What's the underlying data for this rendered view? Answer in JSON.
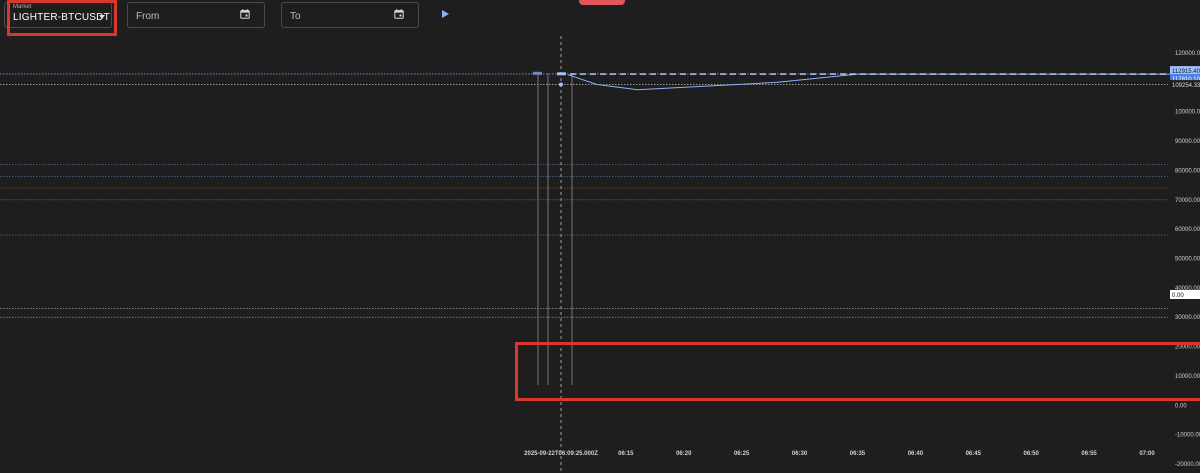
{
  "toolbar": {
    "market_label": "Market",
    "market_value": "LIGHTER-BTCUSDT",
    "from_label": "From",
    "to_label": "To"
  },
  "icons": {
    "dropdown": "chevron-down-icon",
    "calendar": "calendar-icon",
    "run": "play-icon"
  },
  "colors": {
    "background": "#1e1e1e",
    "highlight": "#d9362c",
    "series": "#8ab4f8",
    "tag_blue": "#4c7de0",
    "tag_light": "#9fc0ff",
    "red_tab": "#e0565b"
  },
  "chart_data": {
    "type": "line",
    "y_ticks": [
      "120000.00",
      "110000.00",
      "100000.00",
      "90000.00",
      "80000.00",
      "70000.00",
      "60000.00",
      "50000.00",
      "40000.00",
      "30000.00",
      "20000.00",
      "10000.00",
      "0.00",
      "-10000.00",
      "-20000.00"
    ],
    "x_ticks": [
      "06:15",
      "06:20",
      "06:25",
      "06:30",
      "06:35",
      "06:40",
      "06:45",
      "06:50",
      "06:55",
      "07:00"
    ],
    "crosshair_time": "2025-09-22T06:09:25.000Z",
    "price_tags": [
      "112915.40",
      "112810.10",
      "109254.33",
      "0.00"
    ],
    "ylim": [
      -20000,
      120000
    ],
    "x_range": [
      "06:05",
      "07:02"
    ],
    "series": [
      {
        "values": [
          [
            6.1,
            112600
          ],
          [
            6.125,
            109254
          ],
          [
            6.16,
            107500
          ],
          [
            6.28,
            110000
          ],
          [
            6.35,
            112810
          ],
          [
            7.05,
            112810
          ]
        ]
      }
    ],
    "horizontal_lines": [
      112915.4,
      112810.1,
      109254.33,
      82000,
      78000,
      74000,
      70000,
      58000,
      33000,
      30000
    ],
    "grid": false
  }
}
